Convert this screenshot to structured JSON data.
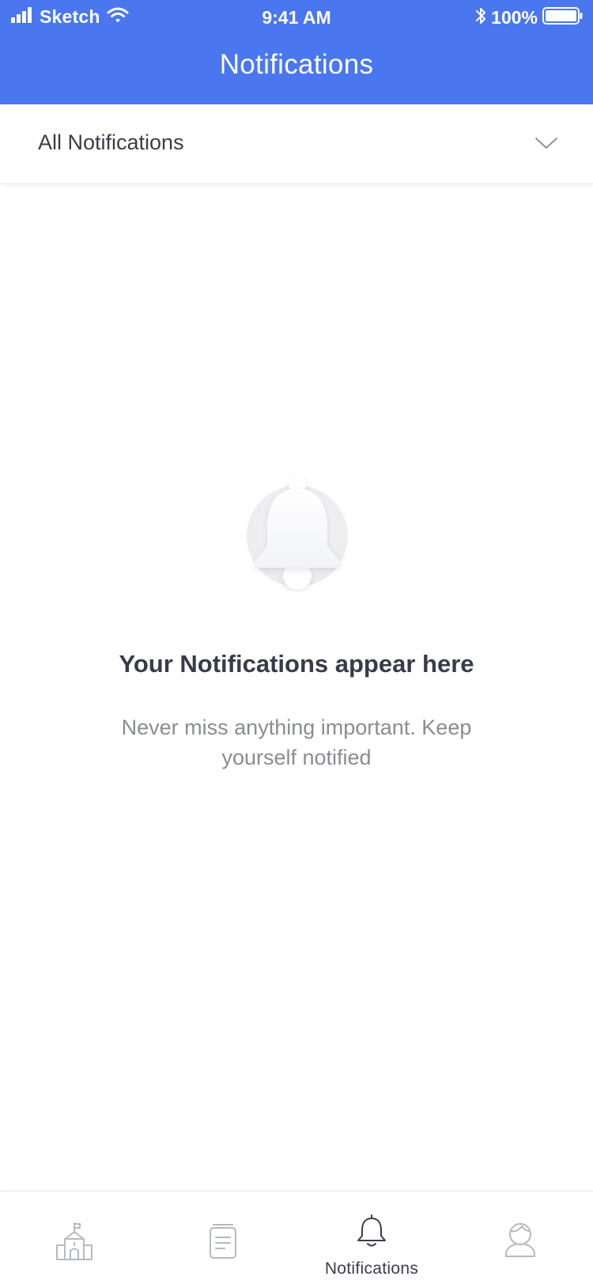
{
  "status_bar": {
    "carrier": "Sketch",
    "time": "9:41 AM",
    "battery": "100%"
  },
  "header": {
    "title": "Notifications"
  },
  "filter": {
    "selected": "All Notifications"
  },
  "empty_state": {
    "title": "Your Notifications appear here",
    "subtitle": "Never miss anything important. Keep yourself notified"
  },
  "tab_bar": {
    "tabs": [
      {
        "icon": "school-icon",
        "label": ""
      },
      {
        "icon": "document-icon",
        "label": ""
      },
      {
        "icon": "bell-icon",
        "label": "Notifications",
        "active": true
      },
      {
        "icon": "profile-icon",
        "label": ""
      }
    ]
  },
  "colors": {
    "header_bg": "#4a77f0",
    "title_text": "#383b4a",
    "subtitle_text": "#8a8c93",
    "tab_icon_inactive": "#b6b9c2",
    "tab_icon_active": "#3b3e4a"
  }
}
